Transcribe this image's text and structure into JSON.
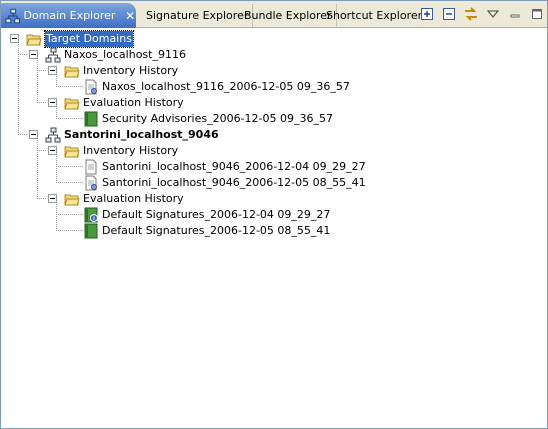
{
  "tabs": [
    {
      "label": "Domain Explorer",
      "active": true,
      "icon": "network-icon"
    },
    {
      "label": "Signature Explorer",
      "active": false
    },
    {
      "label": "Bundle Explorer",
      "active": false
    },
    {
      "label": "Shortcut Explorer",
      "active": false
    }
  ],
  "toolbar": {
    "icons": [
      "expand-all-icon",
      "collapse-all-icon",
      "link-with-editor-icon",
      "view-menu-icon",
      "minimize-icon",
      "maximize-icon"
    ]
  },
  "tree": {
    "root": "Target Domains",
    "domains": [
      {
        "name": "Naxos_localhost_9116",
        "bold": false,
        "inventory_label": "Inventory History",
        "inventory": [
          "Naxos_localhost_9116_2006-12-05 09_36_57"
        ],
        "evaluation_label": "Evaluation History",
        "evaluation": [
          "Security Advisories_2006-12-05 09_36_57"
        ]
      },
      {
        "name": "Santorini_localhost_9046",
        "bold": true,
        "inventory_label": "Inventory History",
        "inventory": [
          "Santorini_localhost_9046_2006-12-04 09_29_27",
          "Santorini_localhost_9046_2006-12-05 08_55_41"
        ],
        "evaluation_label": "Evaluation History",
        "evaluation": [
          "Default Signatures_2006-12-04 09_29_27",
          "Default Signatures_2006-12-05 08_55_41"
        ]
      }
    ]
  },
  "colors": {
    "selection": "#316ac5",
    "tab_active": "#3d6fc4",
    "folder": "#f0c850",
    "book": "#4a9a3c"
  }
}
